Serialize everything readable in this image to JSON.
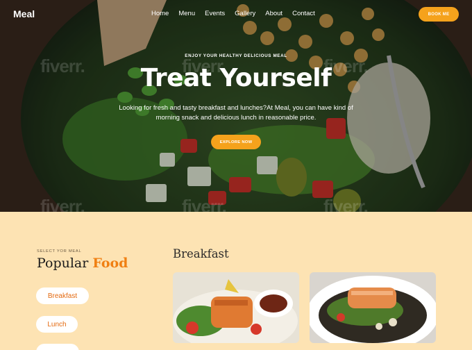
{
  "brand": {
    "logo": "Meal"
  },
  "nav": {
    "items": [
      "Home",
      "Menu",
      "Events",
      "Gallery",
      "About",
      "Contact"
    ],
    "book_label": "BOOK ME"
  },
  "hero": {
    "kicker": "ENJOY YOUR HEALTHY DELICIOUS MEAL",
    "title": "Treat Yourself",
    "subtitle_line1": "Looking for fresh and tasty breakfast and lunches?At Meal, you can have kind of",
    "subtitle_line2": "morning snack and delicious lunch in reasonable price.",
    "cta": "EXPLORE NOW",
    "watermark": "fiverr."
  },
  "menu_section": {
    "kicker": "SELECT YOR MEAL",
    "title_main": "Popular",
    "title_accent": "Food",
    "categories": [
      "Breakfast",
      "Lunch"
    ],
    "active_category_title": "Breakfast"
  },
  "colors": {
    "accent": "#f5a21c",
    "accent_text": "#f07f12",
    "section_bg": "#fde3b3"
  }
}
